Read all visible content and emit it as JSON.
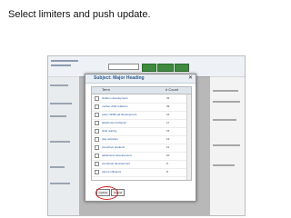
{
  "instruction": "Select limiters and push update.",
  "modal": {
    "title": "Subject: Major Heading",
    "close_glyph": "✕",
    "columns": {
      "name": "Term",
      "count": "# Count"
    },
    "rows": [
      {
        "label": "children development",
        "count": "31"
      },
      {
        "label": "mother child relations",
        "count": "29"
      },
      {
        "label": "early childhood development",
        "count": "21"
      },
      {
        "label": "attachment behavior",
        "count": "17"
      },
      {
        "label": "child rearing",
        "count": "15"
      },
      {
        "label": "play activities",
        "count": "12"
      },
      {
        "label": "preschool students",
        "count": "11"
      },
      {
        "label": "adolescent development",
        "count": "10"
      },
      {
        "label": "emotional development",
        "count": "9"
      },
      {
        "label": "parent influence",
        "count": "8"
      },
      {
        "label": "infant behavior",
        "count": "7"
      }
    ],
    "update_label": "Update",
    "cancel_label": "Cancel"
  }
}
